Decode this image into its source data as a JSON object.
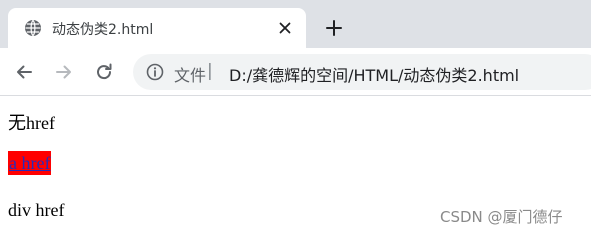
{
  "browser": {
    "tab": {
      "title": "动态伪类2.html",
      "favicon": "globe-icon",
      "close_icon": "close-icon"
    },
    "new_tab_icon": "plus-icon",
    "toolbar": {
      "back_icon": "back-arrow-icon",
      "forward_icon": "forward-arrow-icon",
      "reload_icon": "reload-icon",
      "info_icon": "info-icon",
      "file_label": "文件",
      "separator": "|",
      "url": "D:/龚德辉的空间/HTML/动态伪类2.html"
    }
  },
  "page": {
    "line1": "无href",
    "link": "a href",
    "line3": "div href"
  },
  "watermark": "CSDN @厦门德仔",
  "colors": {
    "chrome_bg": "#dee1e6",
    "link_bg": "#ff0000",
    "link_text": "#2a2ab8"
  }
}
